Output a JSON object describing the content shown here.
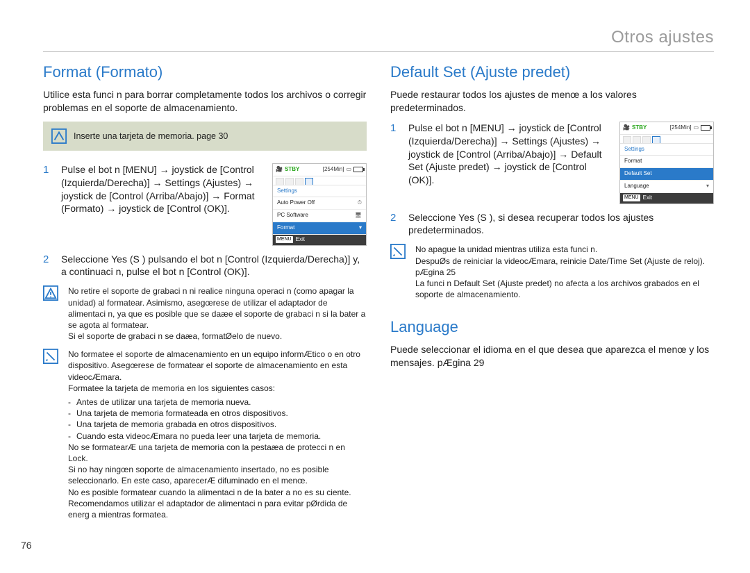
{
  "page_number": "76",
  "breadcrumb": "Otros ajustes",
  "left": {
    "heading": "Format (Formato)",
    "intro": "Utilice esta funci n para borrar completamente todos los archivos o corregir problemas en el soporte de almacenamiento.",
    "note_box": "Inserte una tarjeta de memoria. page 30",
    "step1": "Pulse el bot n [MENU] → joystick de [Control (Izquierda/Derecha)] → Settings (Ajustes) → joystick de [Control (Arriba/Abajo)] → Format (Formato) → joystick de [Control (OK)].",
    "step2": "Seleccione Yes (S ) pulsando el bot n [Control (Izquierda/Derecha)] y, a continuaci n, pulse el bot n [Control (OK)].",
    "warn1": "No retire el soporte de grabaci n ni realice ninguna operaci n (como apagar la unidad) al formatear. Asimismo, asegœrese de utilizar el adaptador de alimentaci n, ya que es posible que se daæe el soporte de grabaci n si la bater a se agota al formatear.",
    "warn1b": "Si el soporte de grabaci n se daæa, formatØelo de nuevo.",
    "note2_p1": "No formatee el soporte de almacenamiento en un equipo informÆtico o en otro dispositivo. Asegœrese de formatear el soporte de almacenamiento en esta videocÆmara.",
    "note2_p2": "Formatee la tarjeta de memoria en los siguientes casos:",
    "note2_bullets": [
      "Antes de utilizar una tarjeta de memoria nueva.",
      "Una tarjeta de memoria formateada en otros dispositivos.",
      "Una tarjeta de memoria grabada en otros dispositivos.",
      "Cuando esta videocÆmara no pueda leer una tarjeta de memoria."
    ],
    "note2_p3": "No se formatearÆ una tarjeta de memoria con la pestaæa de protecci n en Lock.",
    "note2_p4": "Si no hay ningœn soporte de almacenamiento insertado, no es posible seleccionarlo. En este caso, aparecerÆ difuminado en el menœ.",
    "note2_p5": "No es posible formatear cuando la alimentaci n de la bater a no es su ciente. Recomendamos utilizar el adaptador de alimentaci n para evitar pØrdida de energ a mientras formatea.",
    "lcd": {
      "stby": "STBY",
      "time": "[254Min]",
      "heading": "Settings",
      "rows": [
        "Auto Power Off",
        "PC Software",
        "Format"
      ],
      "selected_index": 2,
      "exit": "Exit",
      "menu": "MENU"
    }
  },
  "right": {
    "heading1": "Default Set (Ajuste predet)",
    "intro1": "Puede restaurar todos los ajustes de menœ a los valores predeterminados.",
    "step1": "Pulse el bot n [MENU] → joystick de [Control (Izquierda/Derecha)] → Settings (Ajustes) → joystick de [Control (Arriba/Abajo)] → Default Set (Ajuste predet) → joystick de [Control (OK)].",
    "step2": "Seleccione Yes (S ), si desea recuperar todos los ajustes predeterminados.",
    "note_p1": "No apague la unidad mientras utiliza esta funci n.",
    "note_p2": "DespuØs de reiniciar la videocÆmara, reinicie Date/Time Set (Ajuste de reloj).  pÆgina 25",
    "note_p3": "La funci n Default Set (Ajuste predet) no afecta a los archivos grabados en el soporte de almacenamiento.",
    "heading2": "Language",
    "intro2": "Puede seleccionar el idioma en el que desea que aparezca el menœ y los mensajes.  pÆgina 29",
    "lcd": {
      "stby": "STBY",
      "time": "[254Min]",
      "heading": "Settings",
      "rows": [
        "Format",
        "Default Set",
        "Language"
      ],
      "selected_index": 1,
      "exit": "Exit",
      "menu": "MENU"
    }
  }
}
